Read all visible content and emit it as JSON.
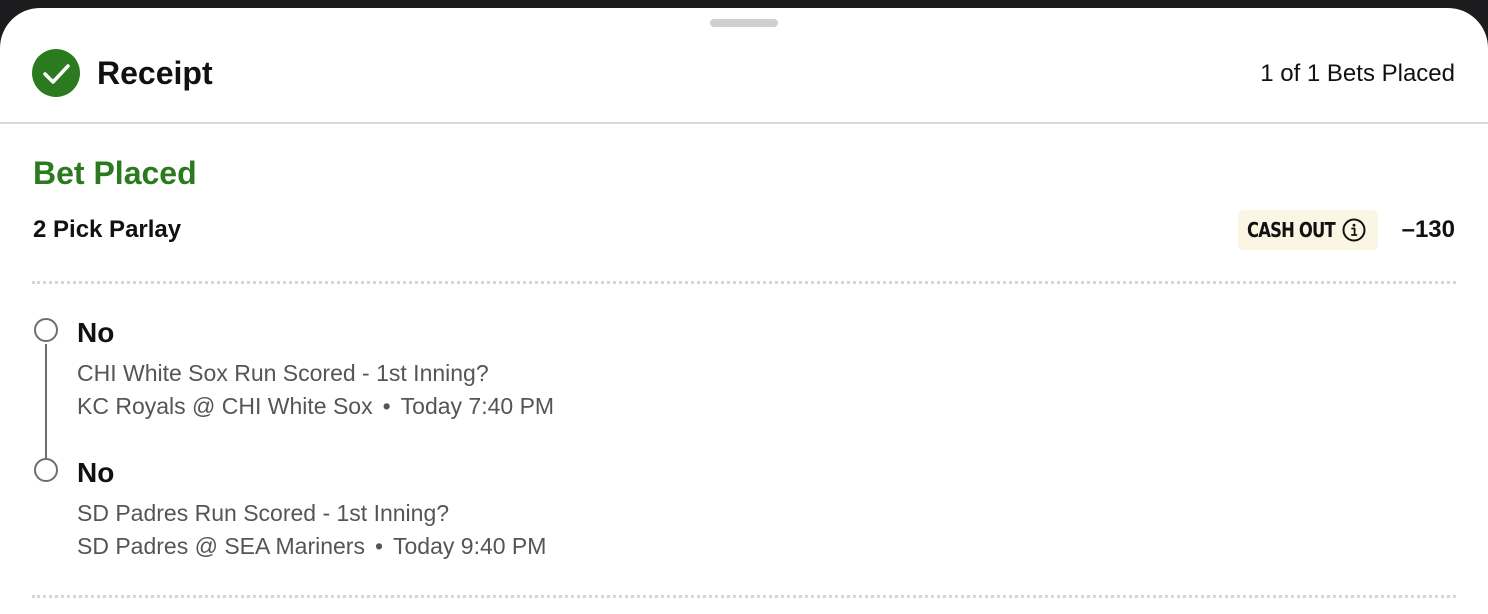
{
  "header": {
    "title": "Receipt",
    "bets_count": "1 of 1 Bets Placed",
    "check_icon": "check-circle-icon",
    "check_color": "#2c7a1f"
  },
  "bet": {
    "status": "Bet Placed",
    "status_color": "#2c7a1f",
    "type": "2 Pick Parlay",
    "cashout_label": "CASH OUT",
    "info_icon": "info-icon",
    "odds": "–130",
    "picks": [
      {
        "selection": "No",
        "market": "CHI White Sox Run Scored - 1st Inning?",
        "matchup": "KC Royals @ CHI White Sox",
        "separator": "•",
        "time": "Today 7:40 PM"
      },
      {
        "selection": "No",
        "market": "SD Padres Run Scored - 1st Inning?",
        "matchup": "SD Padres @ SEA Mariners",
        "separator": "•",
        "time": "Today 9:40 PM"
      }
    ]
  }
}
